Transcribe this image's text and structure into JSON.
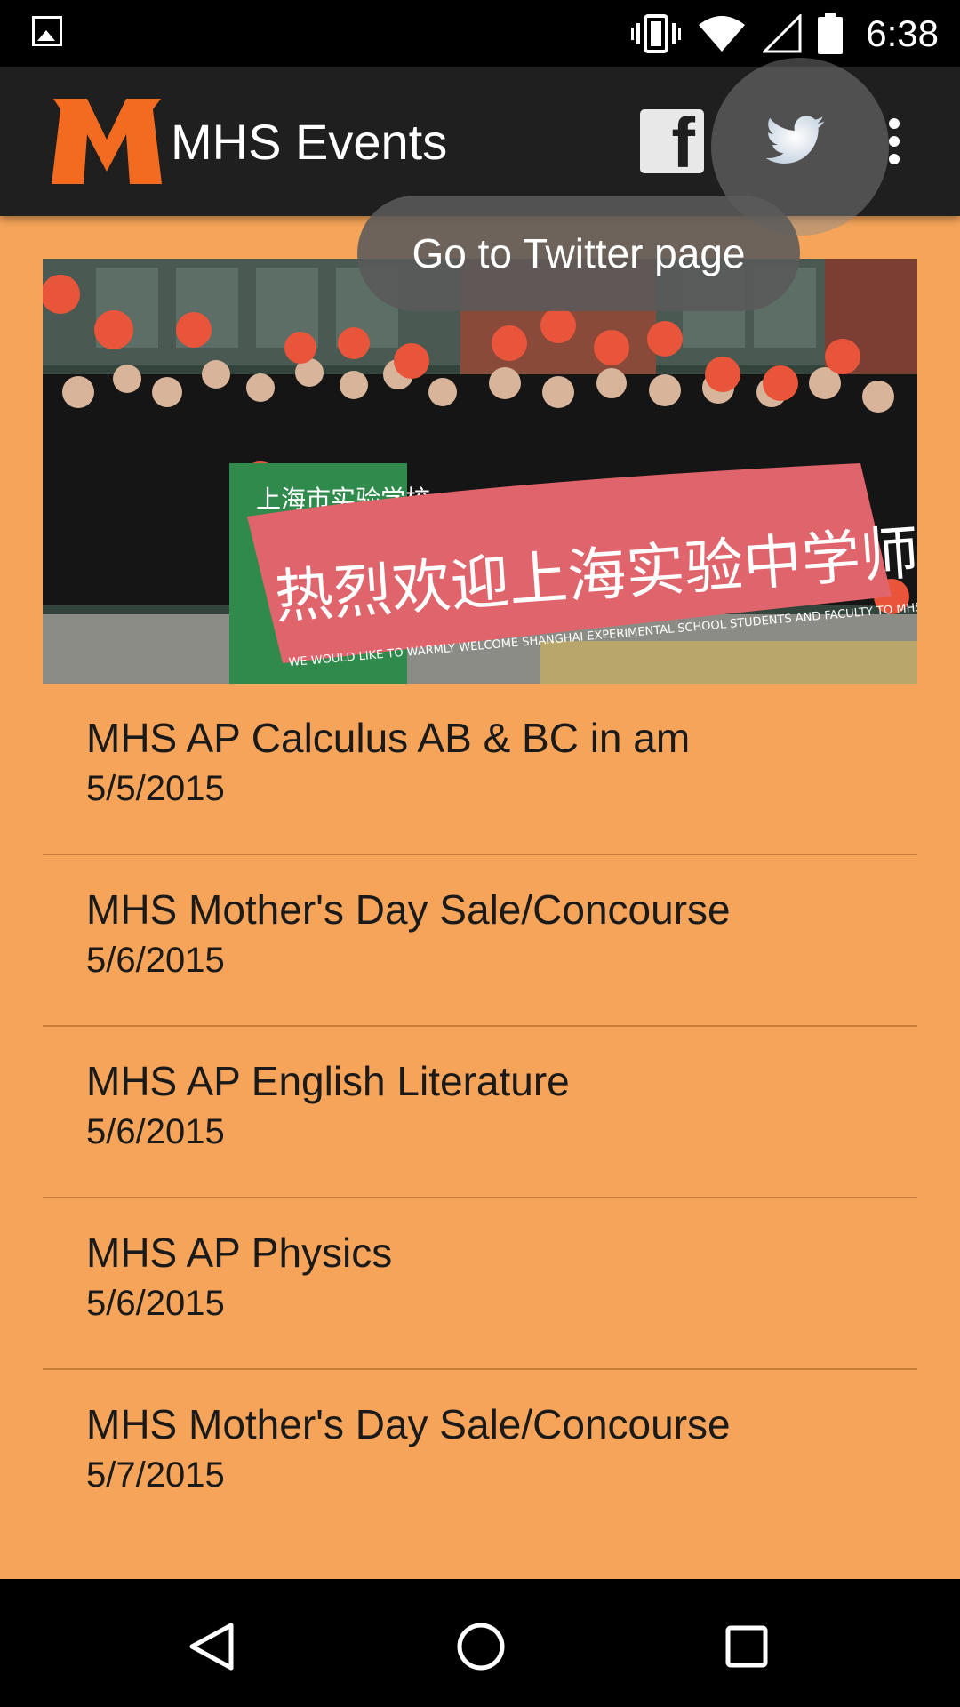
{
  "status_bar": {
    "time": "6:38",
    "icons": [
      "image-notification-icon",
      "vibrate-icon",
      "wifi-icon",
      "cell-signal-icon",
      "battery-icon"
    ]
  },
  "app_bar": {
    "title": "MHS Events",
    "logo_letter": "M",
    "facebook_label": "f",
    "twitter_icon": "twitter-bird-icon",
    "overflow_icon": "overflow-menu-icon"
  },
  "tooltip": {
    "text": "Go to Twitter page"
  },
  "banner": {
    "banner_text_cn": "热烈欢迎上海实验中学师生",
    "sign_text_cn": "上海市实验学校",
    "banner_subtext": "WE WOULD LIKE TO WARMLY WELCOME SHANGHAI EXPERIMENTAL SCHOOL STUDENTS AND FACULTY TO MHS"
  },
  "events": [
    {
      "title": "MHS AP Calculus AB & BC in am",
      "date": "5/5/2015"
    },
    {
      "title": "MHS Mother's Day Sale/Concourse",
      "date": "5/6/2015"
    },
    {
      "title": "MHS AP English Literature",
      "date": "5/6/2015"
    },
    {
      "title": "MHS AP Physics",
      "date": "5/6/2015"
    },
    {
      "title": "MHS Mother's Day Sale/Concourse",
      "date": "5/7/2015"
    }
  ],
  "colors": {
    "background": "#f5a45a",
    "app_bar": "#1f1f1f",
    "logo": "#f26b21",
    "divider": "#c97c3c"
  },
  "nav_bar": {
    "icons": [
      "back-icon",
      "home-icon",
      "recents-icon"
    ]
  }
}
